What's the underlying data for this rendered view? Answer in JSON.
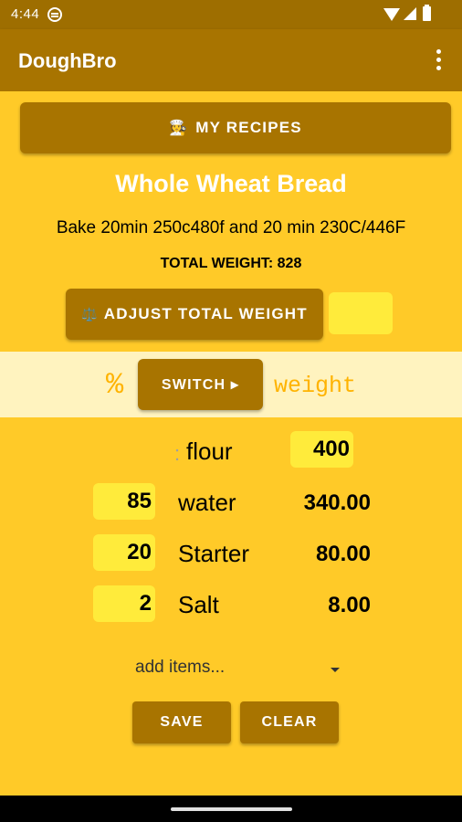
{
  "status_bar": {
    "time": "4:44"
  },
  "app_bar": {
    "title": "DoughBro"
  },
  "recipes_button": {
    "icon": "chef-emoji",
    "emoji": "🧑‍🍳",
    "label": "MY RECIPES"
  },
  "recipe": {
    "name": "Whole Wheat Bread",
    "notes": "Bake 20min 250c480f and 20 min 230C/446F",
    "total_weight_label": "TOTAL WEIGHT: 828"
  },
  "adjust_button": {
    "icon": "scale-icon",
    "emoji": "⚖️",
    "label": "ADJUST TOTAL WEIGHT"
  },
  "adjust_weight_input": {
    "value": ""
  },
  "mode_toggle": {
    "left_label": "%",
    "switch_label": "SWITCH ▸",
    "right_label": "weight"
  },
  "flour": {
    "separator": ":",
    "name": "flour",
    "value": "400"
  },
  "ingredients": [
    {
      "percent": "85",
      "name": "water",
      "weight": "340.00"
    },
    {
      "percent": "20",
      "name": "Starter",
      "weight": "80.00"
    },
    {
      "percent": "2",
      "name": "Salt",
      "weight": "8.00"
    }
  ],
  "add_items": {
    "placeholder": "add items..."
  },
  "actions": {
    "save_label": "SAVE",
    "clear_label": "CLEAR"
  },
  "colors": {
    "accent": "#a87400",
    "background": "#ffca28",
    "input": "#ffeb3b",
    "toggle_bg": "#fff3bf",
    "highlight_text": "#ffb300"
  }
}
